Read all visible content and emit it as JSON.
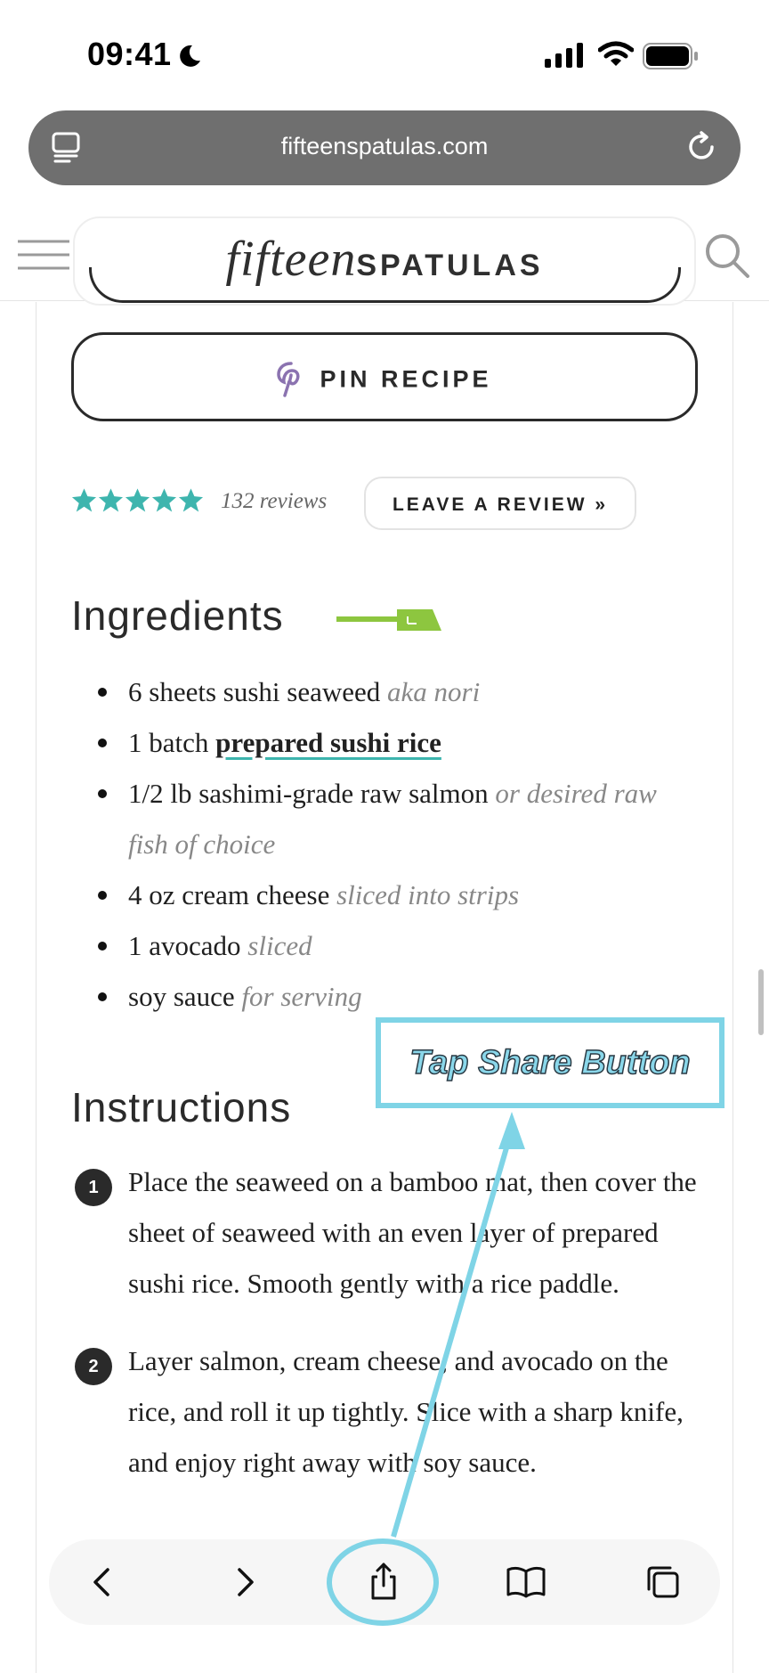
{
  "status_bar": {
    "time": "09:41"
  },
  "browser": {
    "url": "fifteenspatulas.com"
  },
  "site": {
    "logo_script": "fifteen",
    "logo_caps": "SPATULAS"
  },
  "recipe": {
    "pin_button": "PIN RECIPE",
    "rating": 5,
    "reviews": "132 reviews",
    "leave_review": "LEAVE A REVIEW »",
    "ingredients_title": "Ingredients",
    "ingredients": [
      {
        "text": "6 sheets sushi seaweed ",
        "note": "aka nori"
      },
      {
        "prefix": "1 batch ",
        "link": "prepared sushi rice"
      },
      {
        "text": "1/2 lb sashimi-grade raw salmon ",
        "note": "or desired raw fish of choice"
      },
      {
        "text": "4 oz cream cheese ",
        "note": "sliced into strips"
      },
      {
        "text": "1 avocado ",
        "note": "sliced"
      },
      {
        "text": "soy sauce ",
        "note": "for serving"
      }
    ],
    "instructions_title": "Instructions",
    "steps": [
      {
        "number": "1",
        "text": "Place the seaweed on a bamboo mat, then cover the sheet of seaweed with an even layer of prepared sushi rice. Smooth gently with a rice paddle."
      },
      {
        "number": "2",
        "text": "Layer salmon, cream cheese, and avocado on the rice, and roll it up tightly. Slice with a sharp knife, and enjoy right away with soy sauce."
      }
    ]
  },
  "toolbar": {
    "icons": [
      "chevron-left-icon",
      "chevron-right-icon",
      "share-icon",
      "book-icon",
      "tabs-icon"
    ]
  },
  "annotation": {
    "text": "Tap Share Button",
    "color": "#7fd4e6"
  },
  "colors": {
    "accent_teal": "#3eb5ae",
    "spatula_green": "#8dc63f",
    "pinterest_purple": "#8b73b0",
    "address_bar": "#6f6f6f"
  }
}
